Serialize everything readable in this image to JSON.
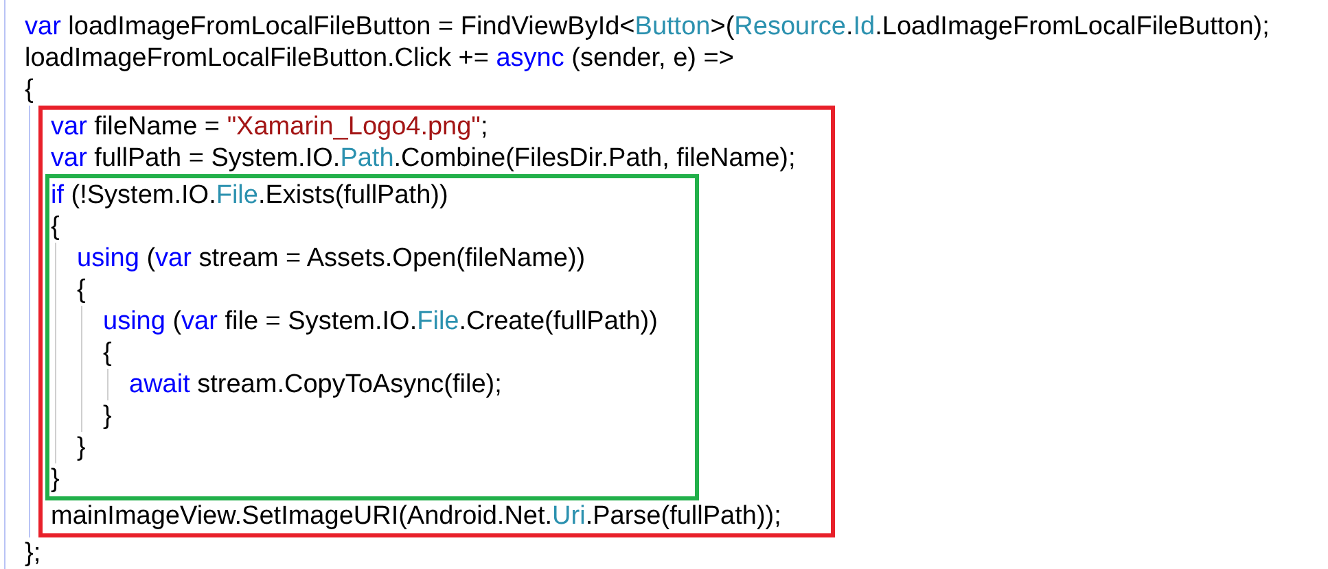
{
  "code": [
    {
      "kind": "line",
      "tokens": [
        {
          "kind": "keyword",
          "text": "var"
        },
        {
          "kind": "plain",
          "text": " loadImageFromLocalFileButton = FindViewById<"
        },
        {
          "kind": "type",
          "text": "Button"
        },
        {
          "kind": "plain",
          "text": ">("
        },
        {
          "kind": "type",
          "text": "Resource"
        },
        {
          "kind": "plain",
          "text": "."
        },
        {
          "kind": "type",
          "text": "Id"
        },
        {
          "kind": "plain",
          "text": ".LoadImageFromLocalFileButton);"
        }
      ]
    },
    {
      "kind": "line",
      "tokens": [
        {
          "kind": "plain",
          "text": "loadImageFromLocalFileButton.Click += "
        },
        {
          "kind": "keyword",
          "text": "async"
        },
        {
          "kind": "plain",
          "text": " (sender, e) =>"
        }
      ]
    },
    {
      "kind": "line",
      "tokens": [
        {
          "kind": "plain",
          "text": "{"
        }
      ],
      "children": [
        {
          "kind": "highlight",
          "color": "#e8202a",
          "children": [
            {
              "kind": "line",
              "tokens": [
                {
                  "kind": "keyword",
                  "text": "var"
                },
                {
                  "kind": "plain",
                  "text": " fileName = "
                },
                {
                  "kind": "string",
                  "text": "\"Xamarin_Logo4.png\""
                },
                {
                  "kind": "plain",
                  "text": ";"
                }
              ]
            },
            {
              "kind": "line",
              "tokens": [
                {
                  "kind": "keyword",
                  "text": "var"
                },
                {
                  "kind": "plain",
                  "text": " fullPath = System.IO."
                },
                {
                  "kind": "type",
                  "text": "Path"
                },
                {
                  "kind": "plain",
                  "text": ".Combine(FilesDir.Path, fileName);"
                }
              ]
            },
            {
              "kind": "highlight",
              "color": "#22b04a",
              "children": [
                {
                  "kind": "line",
                  "tokens": [
                    {
                      "kind": "keyword",
                      "text": "if"
                    },
                    {
                      "kind": "plain",
                      "text": " (!System.IO."
                    },
                    {
                      "kind": "type",
                      "text": "File"
                    },
                    {
                      "kind": "plain",
                      "text": ".Exists(fullPath))"
                    }
                  ]
                },
                {
                  "kind": "line",
                  "tokens": [
                    {
                      "kind": "plain",
                      "text": "{"
                    }
                  ],
                  "children": [
                    {
                      "kind": "line",
                      "tokens": [
                        {
                          "kind": "keyword",
                          "text": "using"
                        },
                        {
                          "kind": "plain",
                          "text": " ("
                        },
                        {
                          "kind": "keyword",
                          "text": "var"
                        },
                        {
                          "kind": "plain",
                          "text": " stream = Assets.Open(fileName))"
                        }
                      ]
                    },
                    {
                      "kind": "line",
                      "tokens": [
                        {
                          "kind": "plain",
                          "text": "{"
                        }
                      ],
                      "children": [
                        {
                          "kind": "line",
                          "tokens": [
                            {
                              "kind": "keyword",
                              "text": "using"
                            },
                            {
                              "kind": "plain",
                              "text": " ("
                            },
                            {
                              "kind": "keyword",
                              "text": "var"
                            },
                            {
                              "kind": "plain",
                              "text": " file = System.IO."
                            },
                            {
                              "kind": "type",
                              "text": "File"
                            },
                            {
                              "kind": "plain",
                              "text": ".Create(fullPath))"
                            }
                          ]
                        },
                        {
                          "kind": "line",
                          "tokens": [
                            {
                              "kind": "plain",
                              "text": "{"
                            }
                          ],
                          "children": [
                            {
                              "kind": "line",
                              "tokens": [
                                {
                                  "kind": "keyword",
                                  "text": "await"
                                },
                                {
                                  "kind": "plain",
                                  "text": " stream.CopyToAsync(file);"
                                }
                              ]
                            }
                          ]
                        },
                        {
                          "kind": "line",
                          "tokens": [
                            {
                              "kind": "plain",
                              "text": "}"
                            }
                          ]
                        }
                      ]
                    },
                    {
                      "kind": "line",
                      "tokens": [
                        {
                          "kind": "plain",
                          "text": "}"
                        }
                      ]
                    }
                  ]
                },
                {
                  "kind": "line",
                  "tokens": [
                    {
                      "kind": "plain",
                      "text": "}"
                    }
                  ]
                }
              ]
            },
            {
              "kind": "line",
              "tokens": [
                {
                  "kind": "plain",
                  "text": "mainImageView.SetImageURI(Android.Net."
                },
                {
                  "kind": "type",
                  "text": "Uri"
                },
                {
                  "kind": "plain",
                  "text": ".Parse(fullPath));"
                }
              ]
            }
          ]
        }
      ]
    },
    {
      "kind": "line",
      "tokens": [
        {
          "kind": "plain",
          "text": "};"
        }
      ]
    }
  ]
}
